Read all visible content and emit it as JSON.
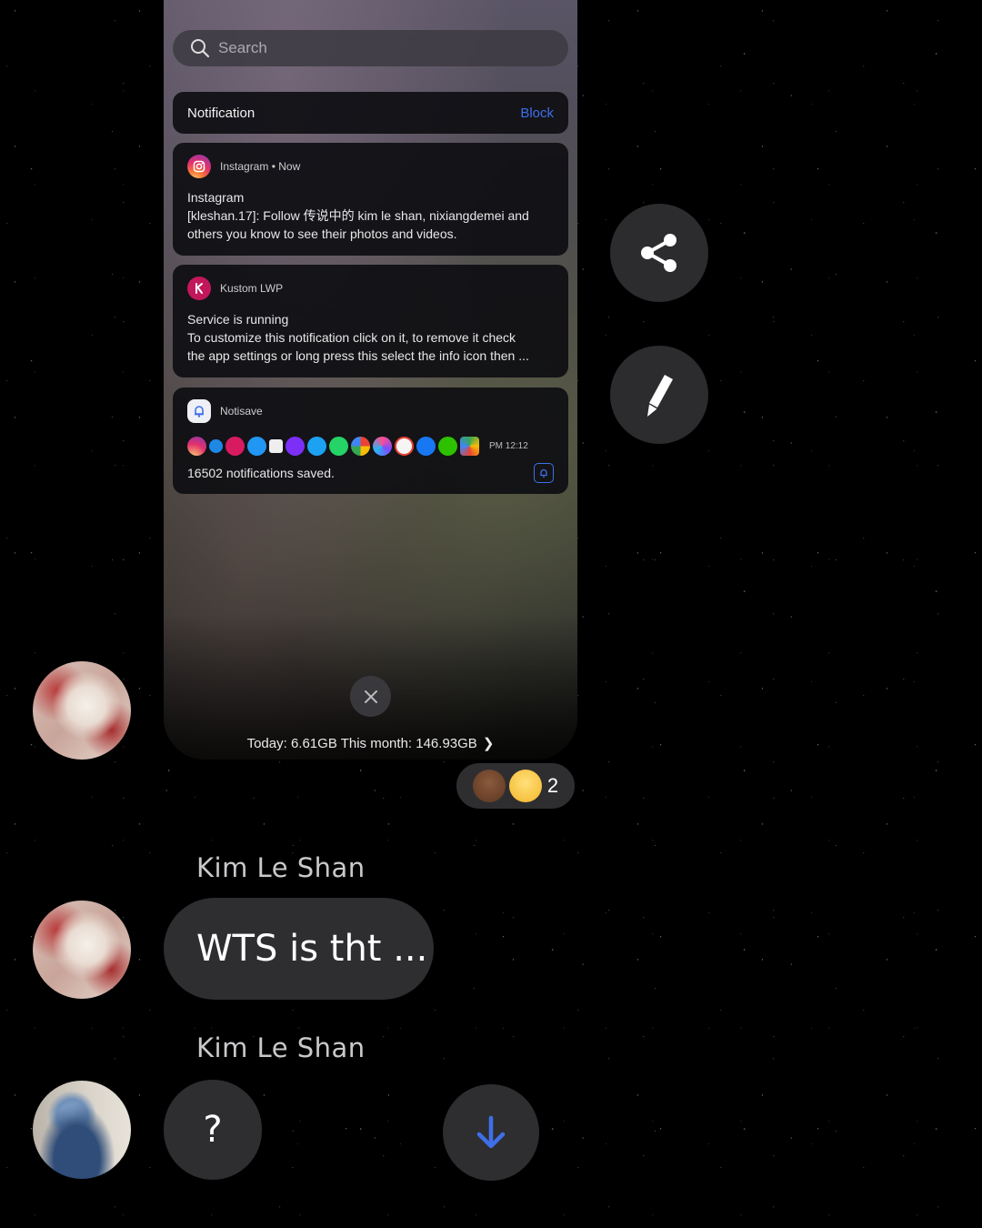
{
  "screenshot_card": {
    "search_placeholder": "Search",
    "notification_header": {
      "title": "Notification",
      "action": "Block"
    },
    "notifications": [
      {
        "app_header": "Instagram • Now",
        "title": "Instagram",
        "body_line1": "[kleshan.17]: Follow 传说中的 kim le shan, nixiangdemei and",
        "body_line2": "others you know to see their photos and videos."
      },
      {
        "app_header": "Kustom LWP",
        "title": "Service is running",
        "body_line1": "To customize this notification click on it, to remove it check",
        "body_line2": "the app settings or long press this select the info icon then ..."
      },
      {
        "app_header": "Notisave",
        "time": "PM 12:12",
        "saved_text": "16502 notifications saved."
      }
    ],
    "usage": "Today: 6.61GB This month: 146.93GB",
    "usage_chevron": "❯"
  },
  "reactions": {
    "count": "2"
  },
  "messages": [
    {
      "sender": "Kim Le Shan",
      "text": "WTS is tht ..."
    },
    {
      "sender": "Kim Le Shan",
      "text": "?"
    }
  ],
  "icons": {
    "share": "share-icon",
    "edit": "pencil-icon",
    "close": "close-icon",
    "scroll_down": "arrow-down-icon"
  },
  "colors": {
    "accent_blue": "#3f6fe8",
    "bubble": "#2e2e31",
    "background": "#000000"
  }
}
